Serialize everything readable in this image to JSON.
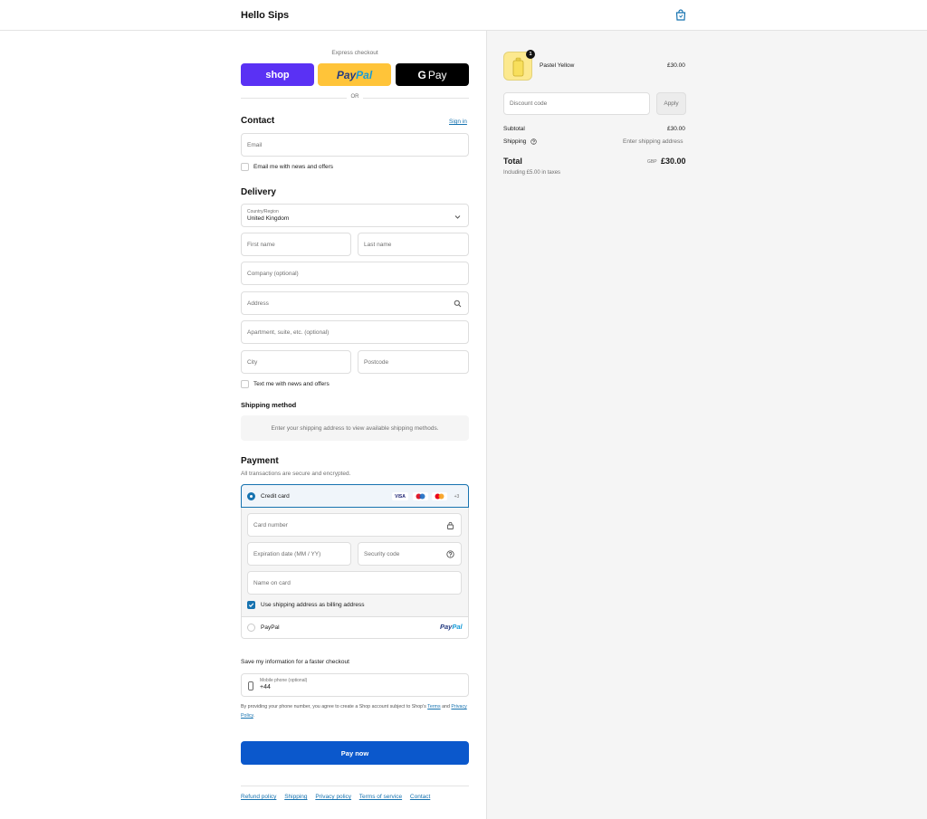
{
  "header": {
    "brand": "Hello Sips",
    "bag_icon": "shopping-bag-icon"
  },
  "express": {
    "label": "Express checkout",
    "shop_label": "shop",
    "paypal_label_1": "Pay",
    "paypal_label_2": "Pal",
    "gpay_g": "G",
    "gpay_label": "Pay",
    "or_label": "OR"
  },
  "contact": {
    "title": "Contact",
    "sign_in": "Sign in",
    "email_placeholder": "Email",
    "newsletter_label": "Email me with news and offers"
  },
  "delivery": {
    "title": "Delivery",
    "country_label": "Country/Region",
    "country_value": "United Kingdom",
    "first_name": "First name",
    "last_name": "Last name",
    "company": "Company (optional)",
    "address": "Address",
    "apartment": "Apartment, suite, etc. (optional)",
    "city": "City",
    "postcode": "Postcode",
    "sms_label": "Text me with news and offers"
  },
  "shipping_method": {
    "title": "Shipping method",
    "message": "Enter your shipping address to view available shipping methods."
  },
  "payment": {
    "title": "Payment",
    "subtitle": "All transactions are secure and encrypted.",
    "credit_card_label": "Credit card",
    "card_logos": [
      "VISA",
      "+3"
    ],
    "card_number": "Card number",
    "expiration": "Expiration date (MM / YY)",
    "security_code": "Security code",
    "name_on_card": "Name on card",
    "billing_label": "Use shipping address as billing address",
    "paypal_label": "PayPal",
    "paypal_logo_1": "Pay",
    "paypal_logo_2": "Pal"
  },
  "remember": {
    "title": "Save my information for a faster checkout",
    "phone_label": "Mobile phone (optional)",
    "phone_value": "+44",
    "legal_1": "By providing your phone number, you agree to create a Shop account subject to Shop's",
    "terms": "Terms",
    "legal_and": "and",
    "privacy": "Privacy Policy",
    "legal_end": "."
  },
  "pay_now": "Pay now",
  "footer": {
    "links": [
      "Refund policy",
      "Shipping",
      "Privacy policy",
      "Terms of service",
      "Contact"
    ]
  },
  "summary": {
    "item_name": "Pastel Yellow",
    "item_price": "£30.00",
    "item_qty": "1",
    "discount_placeholder": "Discount code",
    "apply_label": "Apply",
    "subtotal_label": "Subtotal",
    "subtotal_value": "£30.00",
    "shipping_label": "Shipping",
    "shipping_value": "Enter shipping address",
    "total_label": "Total",
    "currency": "GBP",
    "total_value": "£30.00",
    "tax_note": "Including £5.00 in taxes"
  },
  "colors": {
    "accent": "#1773b0",
    "pay_button": "#0b58cc",
    "shop": "#5a31f4",
    "paypal": "#ffc439"
  }
}
